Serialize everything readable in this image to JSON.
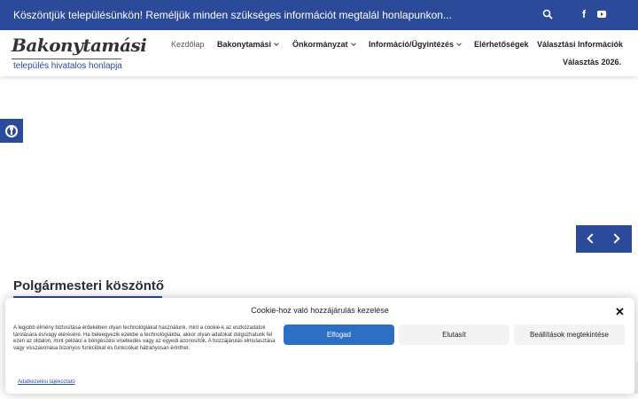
{
  "topbar": {
    "message": "Köszöntjük településünkön! Reméljük minden szükséges információt megtalál honlapunkon...",
    "search_icon": "search-icon",
    "facebook_icon": "facebook-icon",
    "facebook_glyph": "f",
    "youtube_icon": "youtube-icon",
    "color": "#2c4a9a"
  },
  "header": {
    "logo_text": "Bakonytamási",
    "logo_tagline": "település hivatalos honlapja",
    "nav": {
      "home": "Kezdőlap",
      "bakonytamasi": "Bakonytamási",
      "onkormanyzat": "Önkormányzat",
      "informacio": "Információ/Ügyintézés",
      "elerhetosegek": "Elérhetőségek",
      "valasztasi": "Választási Információk",
      "valasztas2026": "Választás 2026."
    }
  },
  "slider": {
    "prev_icon": "chevron-left-icon",
    "next_icon": "chevron-right-icon"
  },
  "main": {
    "section_title": "Polgármesteri köszöntő"
  },
  "cookie": {
    "title": "Cookie-hoz való hozzájárulás kezelése",
    "close_glyph": "✕",
    "description": "A legjobb élmény biztosítása érdekében olyan technológiákat használunk, mint a cookie-k az eszközadatok tárolására és/vagy elérésére. Ha beleegyezik ezekbe a technológiákba, akkor olyan adatokat dolgozhatunk fel ezen az oldalon, mint például a böngészési viselkedés vagy az egyedi azonosítók. A hozzájárulás elmulasztása vagy visszavonása bizonyos funkciókat és funkciókat hátrányosan érinthet.",
    "accept_label": "Elfogad",
    "deny_label": "Elutasít",
    "prefs_label": "Beállítások megtekintése",
    "policy_link": "Adatkezelési tájékoztató",
    "accent": "#2c6fc4"
  }
}
